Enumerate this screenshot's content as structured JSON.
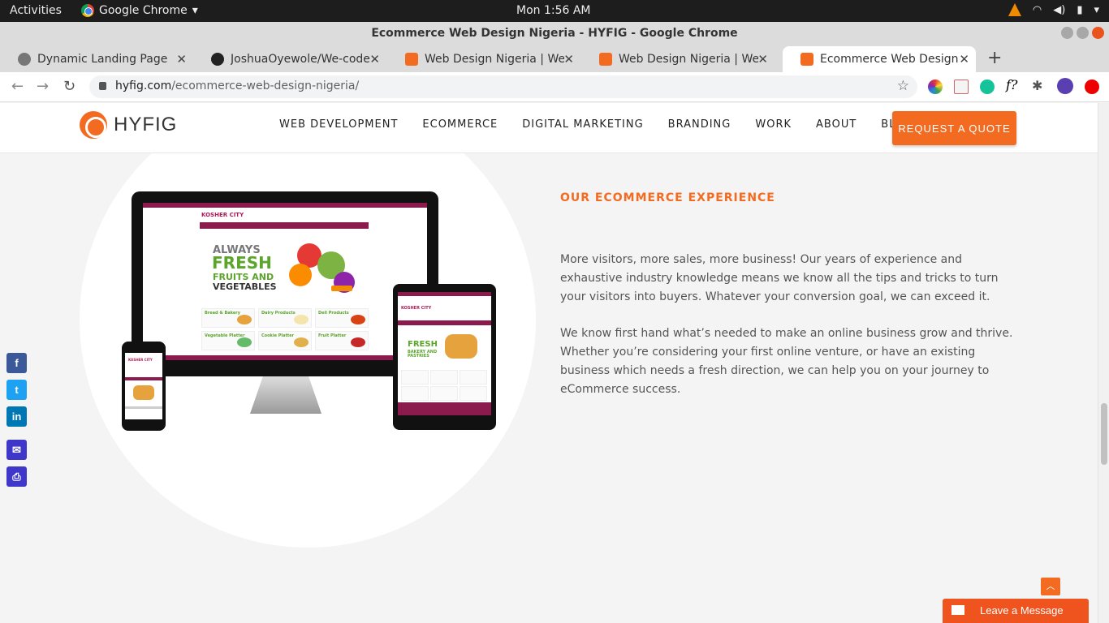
{
  "system": {
    "activities": "Activities",
    "app_name": "Google Chrome",
    "clock": "Mon  1:56 AM"
  },
  "window": {
    "title": "Ecommerce Web Design Nigeria - HYFIG - Google Chrome"
  },
  "tabs": [
    {
      "label": "Dynamic Landing Page",
      "icon": "globe-icon"
    },
    {
      "label": "JoshuaOyewole/We-code",
      "icon": "github-icon"
    },
    {
      "label": "Web Design Nigeria | Web",
      "icon": "hyfig-icon"
    },
    {
      "label": "Web Design Nigeria | Web",
      "icon": "hyfig-icon"
    },
    {
      "label": "Ecommerce Web Design N",
      "icon": "hyfig-icon",
      "active": true
    }
  ],
  "address_bar": {
    "domain": "hyfig.com",
    "path": "/ecommerce-web-design-nigeria/"
  },
  "site": {
    "logo_text": "HYFIG",
    "nav": [
      "WEB DEVELOPMENT",
      "ECOMMERCE",
      "DIGITAL MARKETING",
      "BRANDING",
      "WORK",
      "ABOUT",
      "BLOG"
    ],
    "cta": "REQUEST A QUOTE",
    "accent_color": "#f26b21"
  },
  "content": {
    "section_title": "OUR ECOMMERCE EXPERIENCE",
    "paragraph1": "More visitors, more sales, more business! Our years of experience and exhaustive industry knowledge means we know all the tips and tricks to turn your visitors into buyers. Whatever your conversion goal, we can exceed it.",
    "paragraph2": "We know first hand what’s needed to make an online business grow and thrive. Whether you’re considering your first online venture, or have an existing business which needs a fresh direction, we can help you on your journey to eCommerce success."
  },
  "mockup": {
    "logo": "KOSHER CITY",
    "hero_line1": "ALWAYS",
    "hero_line2": "FRESH",
    "hero_line3": "FRUITS AND",
    "hero_line4": "VEGETABLES",
    "tablet_hero": "FRESH",
    "tablet_sub": "BAKERY AND PASTRIES",
    "cells": [
      "Bread & Bakery",
      "Dairy Products",
      "Deli Products",
      "Vegetable Platter",
      "Cookie Platter",
      "Fruit Platter"
    ]
  },
  "share": [
    {
      "icon": "facebook-icon",
      "glyph": "f",
      "color": "#3b5998"
    },
    {
      "icon": "twitter-icon",
      "glyph": "t",
      "color": "#1da1f2"
    },
    {
      "icon": "linkedin-icon",
      "glyph": "in",
      "color": "#0077b5"
    },
    {
      "icon": "email-icon",
      "glyph": "✉",
      "color": "#3f37c9"
    },
    {
      "icon": "print-icon",
      "glyph": "⎙",
      "color": "#3f37c9"
    }
  ],
  "chat": {
    "label": "Leave a Message"
  }
}
